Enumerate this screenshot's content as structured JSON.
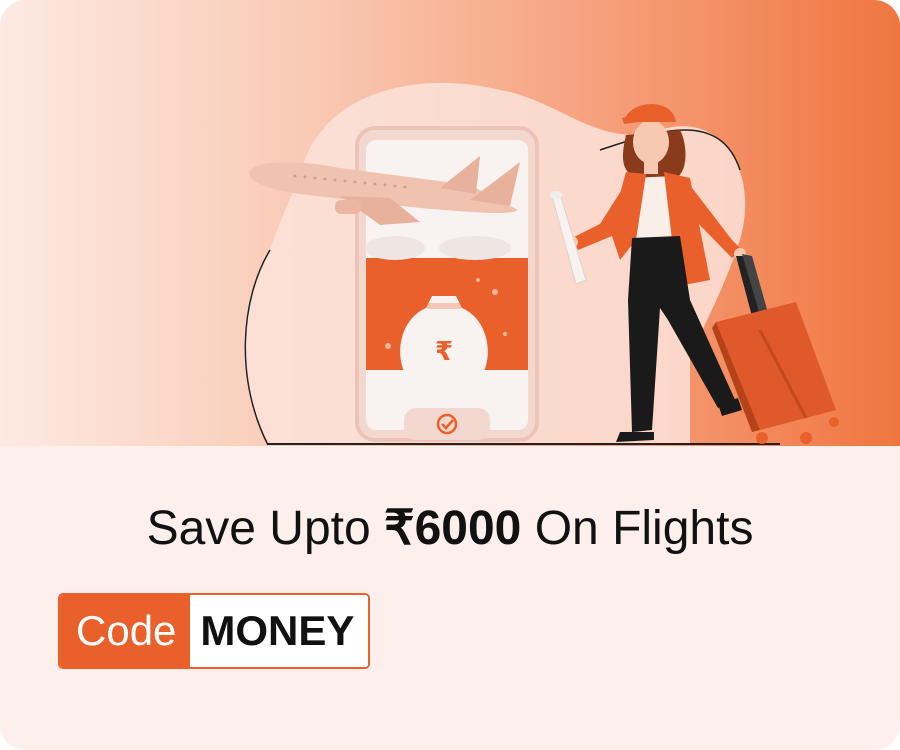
{
  "banner": {
    "illustration": "woman-traveler-with-suitcase-airplane-phone-rupee-bag",
    "icons": [
      "airplane-icon",
      "phone-icon",
      "rupee-money-bag-icon",
      "check-icon",
      "suitcase-icon",
      "map-scroll-icon"
    ]
  },
  "offer": {
    "headline_prefix": "Save Upto ",
    "headline_amount": "₹6000",
    "headline_suffix": " On Flights"
  },
  "coupon": {
    "label": "Code",
    "code": "MONEY"
  },
  "colors": {
    "accent": "#e9602a",
    "background": "#fdf0ec",
    "text": "#111111"
  }
}
